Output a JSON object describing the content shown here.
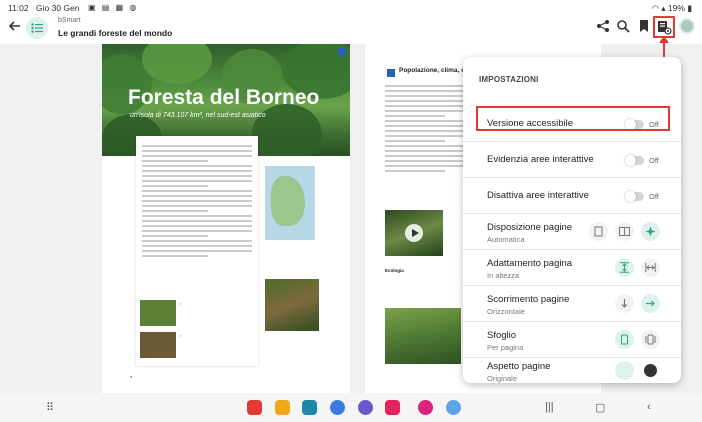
{
  "status_bar": {
    "time": "11:02",
    "date": "Gio 30 Gen",
    "battery": "19%"
  },
  "header": {
    "app_name": "bSmart",
    "book_title": "Le grandi foreste del mondo",
    "icons": [
      "share-icon",
      "search-icon",
      "bookmark-icon",
      "settings-book-icon",
      "avatar"
    ]
  },
  "page_left": {
    "title": "Foresta del Borneo",
    "subtitle": "un'isola di 743.107 km², nel sud-est asiatico"
  },
  "page_right": {
    "section_title": "Popolazione, clima, or",
    "subsection": "Ecologia"
  },
  "settings": {
    "title": "IMPOSTAZIONI",
    "rows": [
      {
        "label": "Versione accessibile",
        "state": "Off"
      },
      {
        "label": "Evidenzia aree interattive",
        "state": "Off"
      },
      {
        "label": "Disattiva aree interattive",
        "state": "Off"
      }
    ],
    "options": [
      {
        "label": "Disposizione pagine",
        "value": "Automatica"
      },
      {
        "label": "Adattamento pagina",
        "value": "In altezza"
      },
      {
        "label": "Scorrimento pagine",
        "value": "Orizzontale"
      },
      {
        "label": "Sfoglio",
        "value": "Per pagina"
      },
      {
        "label": "Aspetto pagine",
        "value": "Originale"
      }
    ]
  },
  "colors": {
    "accent": "#2fa58a",
    "highlight": "#e53935"
  }
}
